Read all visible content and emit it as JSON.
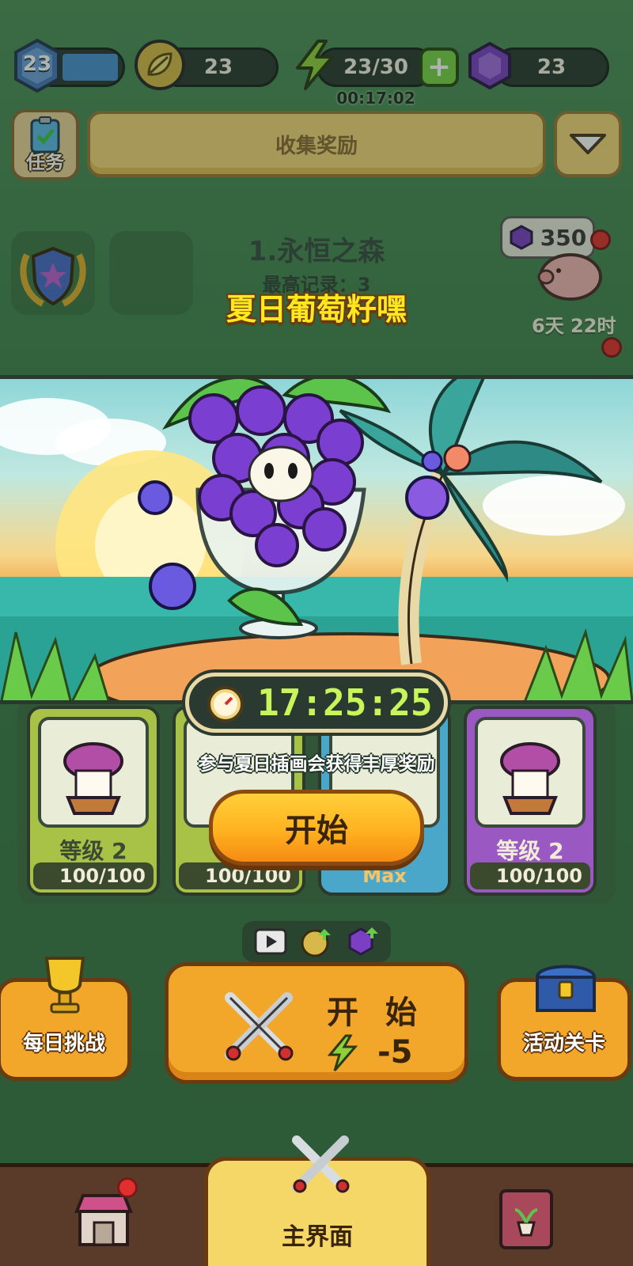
{
  "top_bar": {
    "level": "23",
    "leaf_count": "23",
    "energy": "23/30",
    "energy_timer": "00:17:02",
    "gem_count": "23"
  },
  "task": {
    "label": "任务"
  },
  "collect_bar": {
    "label": "收集奖励"
  },
  "stage": {
    "title": "1.永恒之森",
    "best_record": "最高记录：3"
  },
  "piggy": {
    "gems": "350",
    "time_left": "6天 22时"
  },
  "event": {
    "title": "夏日葡萄籽嘿",
    "countdown": "17:25:25",
    "description": "参与夏日插画会获得丰厚奖励",
    "start_label": "开始"
  },
  "cards": [
    {
      "level": "等级 2",
      "fragments": "100/100",
      "theme": "#a7c247"
    },
    {
      "level": "",
      "fragments": "100/100",
      "theme": "#a7c247"
    },
    {
      "level": "",
      "fragments": "Max",
      "theme": "#4aa7c9"
    },
    {
      "level": "等级 2",
      "fragments": "100/100",
      "theme": "#9a58c2"
    }
  ],
  "actions": {
    "daily_challenge": "每日挑战",
    "start_label": "开 始",
    "start_cost": "-5",
    "event_stage": "活动关卡"
  },
  "nav": {
    "main_label": "主界面"
  },
  "icons": [
    "level-star-icon",
    "leaf-icon",
    "lightning-icon",
    "plus-icon",
    "gem-icon",
    "clipboard-icon",
    "chevron-down-icon",
    "laurel-shield-icon",
    "piggy-bank-icon",
    "stopwatch-icon",
    "video-icon",
    "trophy-icon",
    "crossed-swords-icon",
    "treasure-chest-icon",
    "shop-icon",
    "plant-book-icon"
  ]
}
